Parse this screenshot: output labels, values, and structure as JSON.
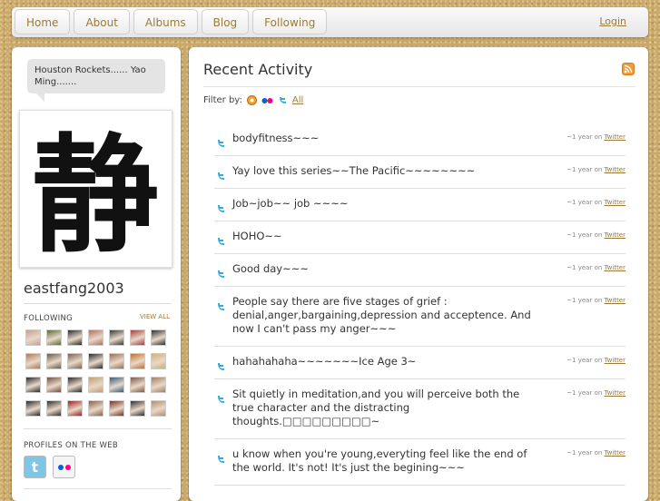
{
  "nav": {
    "tabs": [
      "Home",
      "About",
      "Albums",
      "Blog",
      "Following"
    ],
    "login": "Login"
  },
  "sidebar": {
    "status": "Houston Rockets...... Yao Ming.......",
    "avatar_glyph": "静",
    "username": "eastfang2003",
    "following_label": "FOLLOWING",
    "view_all": "VIEW ALL",
    "profiles_label": "PROFILES ON THE WEB",
    "following_colors": [
      "#c8a090",
      "#5a6a3a",
      "#2a2a2a",
      "#b07060",
      "#3a3a3a",
      "#a04040",
      "#303030",
      "#b07a50",
      "#6a5a4a",
      "#806050",
      "#2a2a2a",
      "#9a7050",
      "#c07030",
      "#d0b070",
      "#2a2a2a",
      "#705040",
      "#2a2a2a",
      "#c0a070",
      "#3a5a7a",
      "#7a5a4a",
      "#a08060",
      "#2a2a2a",
      "#303030",
      "#a02020",
      "#8a6050",
      "#7a3020",
      "#303030",
      "#b09070"
    ]
  },
  "main": {
    "title": "Recent Activity",
    "filter_label": "Filter by:",
    "filter_all": "All",
    "items": [
      {
        "text": "bodyfitness~~~",
        "time": "~1 year on",
        "source": "Twitter"
      },
      {
        "text": "Yay love this series~~The Pacific~~~~~~~~",
        "time": "~1 year on",
        "source": "Twitter"
      },
      {
        "text": "Job~job~~ job ~~~~",
        "time": "~1 year on",
        "source": "Twitter"
      },
      {
        "text": "HOHO~~",
        "time": "~1 year on",
        "source": "Twitter"
      },
      {
        "text": "Good day~~~",
        "time": "~1 year on",
        "source": "Twitter"
      },
      {
        "text": "People say there are five stages of grief : denial,anger,bargaining,depression and acceptence. And now I can't pass my anger~~~",
        "time": "~1 year on",
        "source": "Twitter"
      },
      {
        "text": "hahahahaha~~~~~~~Ice Age 3~",
        "time": "~1 year on",
        "source": "Twitter"
      },
      {
        "text": "Sit quietly in meditation,and you will perceive both the true character and the distracting thoughts.□□□□□□□□□~",
        "time": "~1 year on",
        "source": "Twitter"
      },
      {
        "text": "u know when you're young,everyting feel like the end of the world. It's not! It's just the begining~~~",
        "time": "~1 year on",
        "source": "Twitter"
      }
    ]
  },
  "colors": {
    "accent": "#9a7a3a",
    "twitter": "#33aadd",
    "flickr_blue": "#0063dc",
    "flickr_pink": "#ff0084"
  }
}
